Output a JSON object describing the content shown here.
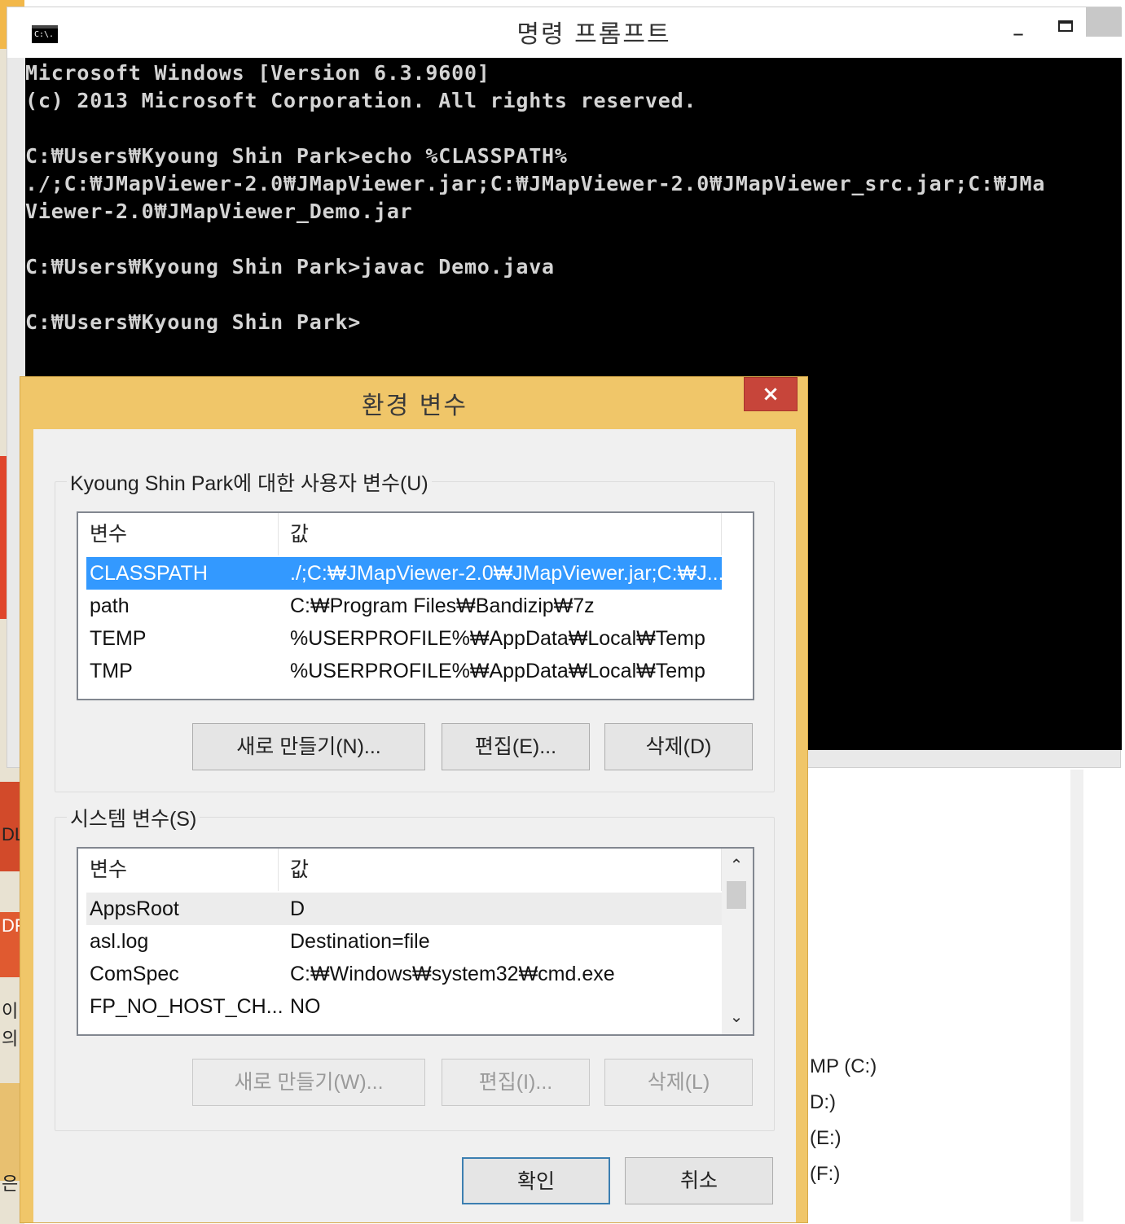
{
  "cmd": {
    "title": "명령 프롬프트",
    "app_icon_text": "C:\\.",
    "min_glyph": "–",
    "lines": [
      "Microsoft Windows [Version 6.3.9600]",
      "(c) 2013 Microsoft Corporation. All rights reserved.",
      "",
      "C:₩Users₩Kyoung Shin Park>echo %CLASSPATH%",
      "./;C:₩JMapViewer-2.0₩JMapViewer.jar;C:₩JMapViewer-2.0₩JMapViewer_src.jar;C:₩JMa",
      "Viewer-2.0₩JMapViewer_Demo.jar",
      "",
      "C:₩Users₩Kyoung Shin Park>javac Demo.java",
      "",
      "C:₩Users₩Kyoung Shin Park>"
    ]
  },
  "background": {
    "drives": [
      "MP (C:)",
      "D:)",
      "(E:)",
      "(F:)"
    ],
    "strip_fragments": [
      "DL",
      "DF",
      "이",
      "의",
      "은"
    ]
  },
  "dialog": {
    "title": "환경 변수",
    "close_glyph": "×",
    "user_group": {
      "label": "Kyoung Shin Park에 대한 사용자 변수(U)",
      "columns": [
        "변수",
        "값"
      ],
      "rows": [
        {
          "name": "CLASSPATH",
          "value": "./;C:₩JMapViewer-2.0₩JMapViewer.jar;C:₩J...",
          "selected": true
        },
        {
          "name": "path",
          "value": "C:₩Program Files₩Bandizip₩7z"
        },
        {
          "name": "TEMP",
          "value": "%USERPROFILE%₩AppData₩Local₩Temp"
        },
        {
          "name": "TMP",
          "value": "%USERPROFILE%₩AppData₩Local₩Temp"
        }
      ],
      "buttons": {
        "new": "새로 만들기(N)...",
        "edit": "편집(E)...",
        "delete": "삭제(D)"
      }
    },
    "system_group": {
      "label": "시스템 변수(S)",
      "columns": [
        "변수",
        "값"
      ],
      "rows": [
        {
          "name": "AppsRoot",
          "value": "D",
          "hover": true
        },
        {
          "name": "asl.log",
          "value": "Destination=file"
        },
        {
          "name": "ComSpec",
          "value": "C:₩Windows₩system32₩cmd.exe"
        },
        {
          "name": "FP_NO_HOST_CH...",
          "value": "NO"
        }
      ],
      "scroll_up": "⌃",
      "scroll_down": "⌄",
      "buttons": {
        "new": "새로 만들기(W)...",
        "edit": "편집(I)...",
        "delete": "삭제(L)"
      }
    },
    "ok": "확인",
    "cancel": "취소"
  },
  "colors": {
    "dialog_frame": "#f0c669",
    "selection": "#3399ff",
    "close_button": "#c7453a",
    "console_bg": "#000000",
    "console_text": "#d4d4d4"
  }
}
